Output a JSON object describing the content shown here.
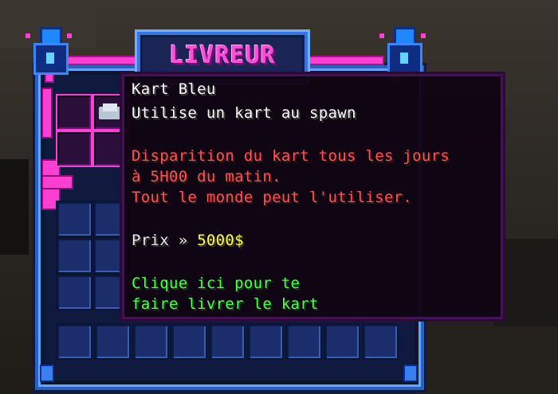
{
  "gui": {
    "title": "LIVREUR"
  },
  "tooltip": {
    "item_name": "Kart Bleu",
    "description": "Utilise un kart au spawn",
    "warning_lines": [
      "Disparition du kart tous les jours",
      "à 5H00 du matin.",
      "Tout le monde peut l'utiliser."
    ],
    "price_label": "Prix » ",
    "price_value": "5000$",
    "action_lines": [
      "Clique ici pour te",
      "faire livrer le kart"
    ]
  },
  "colors": {
    "title_pink": "#ff4fd8",
    "frame_blue": "#2a5fc4",
    "warning_red": "#ff5555",
    "price_yellow": "#ffff55",
    "action_green": "#55ff55"
  },
  "icons": {
    "slot_item": "kart-item-icon",
    "ornaments": [
      "crystal-lamp-icon",
      "crystal-lamp-icon"
    ]
  }
}
